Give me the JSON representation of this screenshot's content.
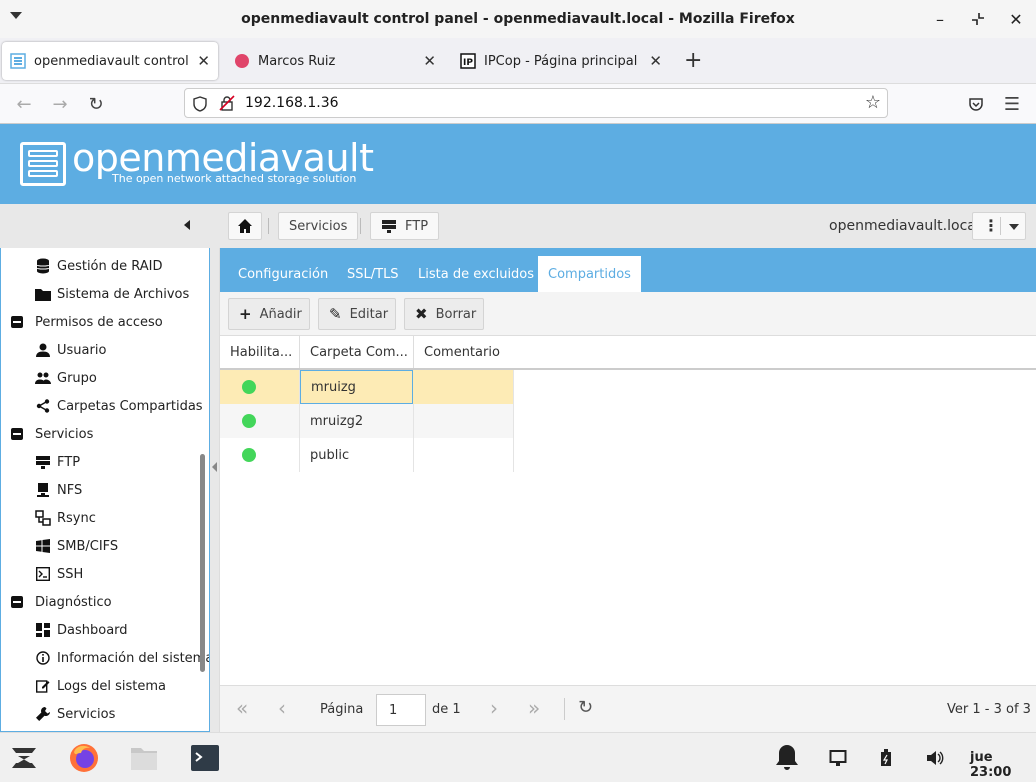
{
  "window": {
    "title": "openmediavault control panel - openmediavault.local - Mozilla Firefox",
    "minimize": "–",
    "close": "✕"
  },
  "browser_tabs": [
    {
      "label": "openmediavault control pa",
      "close": "✕"
    },
    {
      "label": "Marcos Ruiz",
      "close": "✕"
    },
    {
      "label": "IPCop - Página principal",
      "close": "✕"
    }
  ],
  "new_tab": "+",
  "nav": {
    "back": "←",
    "forward": "→",
    "reload": "↻",
    "url": "192.168.1.36",
    "bookmark": "☆",
    "menu": "☰"
  },
  "omv": {
    "name": "openmediavault",
    "tagline": "The open network attached storage solution"
  },
  "breadcrumb": {
    "home_icon": "⌂",
    "services": "Servicios",
    "ftp": "FTP"
  },
  "hostname": "openmediavault.local",
  "more_menu": "⋮",
  "sidebar": {
    "items": [
      {
        "label": "Gestión de RAID",
        "icon": "⛁"
      },
      {
        "label": "Sistema de Archivos",
        "icon": "▬"
      },
      {
        "label": "Permisos de acceso",
        "group": true
      },
      {
        "label": "Usuario",
        "icon": "👤"
      },
      {
        "label": "Grupo",
        "icon": "👥"
      },
      {
        "label": "Carpetas Compartidas",
        "icon": "<"
      },
      {
        "label": "Servicios",
        "group": true
      },
      {
        "label": "FTP",
        "icon": "☰"
      },
      {
        "label": "NFS",
        "icon": "▀"
      },
      {
        "label": "Rsync",
        "icon": "⊡"
      },
      {
        "label": "SMB/CIFS",
        "icon": "⊞"
      },
      {
        "label": "SSH",
        "icon": ">_"
      },
      {
        "label": "Diagnóstico",
        "group": true
      },
      {
        "label": "Dashboard",
        "icon": "▦"
      },
      {
        "label": "Información del sistema",
        "icon": "ⓘ"
      },
      {
        "label": "Logs del sistema",
        "icon": "✎"
      },
      {
        "label": "Servicios",
        "icon": "🔧"
      }
    ]
  },
  "subtabs": [
    {
      "label": "Configuración"
    },
    {
      "label": "SSL/TLS"
    },
    {
      "label": "Lista de excluidos"
    },
    {
      "label": "Compartidos",
      "active": true
    }
  ],
  "actions": {
    "add": {
      "label": "Añadir",
      "icon": "+"
    },
    "edit": {
      "label": "Editar",
      "icon": "✎"
    },
    "delete": {
      "label": "Borrar",
      "icon": "✖"
    }
  },
  "grid": {
    "columns": [
      "Habilita...",
      "Carpeta Com...",
      "Comentario"
    ],
    "rows": [
      {
        "enabled": true,
        "folder": "mruizg",
        "comment": ""
      },
      {
        "enabled": true,
        "folder": "mruizg2",
        "comment": ""
      },
      {
        "enabled": true,
        "folder": "public",
        "comment": ""
      }
    ]
  },
  "pager": {
    "first": "«",
    "prev": "‹",
    "page_label": "Página",
    "page_value": "1",
    "of_label": "de 1",
    "next": "›",
    "last": "»",
    "refresh": "↻",
    "summary": "Ver 1 - 3 of 3"
  },
  "taskbar": {
    "clock": "jue 23:00"
  },
  "colors": {
    "accent": "#5dade2",
    "selected_row": "#fdebb5",
    "status_on": "#43d65a"
  }
}
